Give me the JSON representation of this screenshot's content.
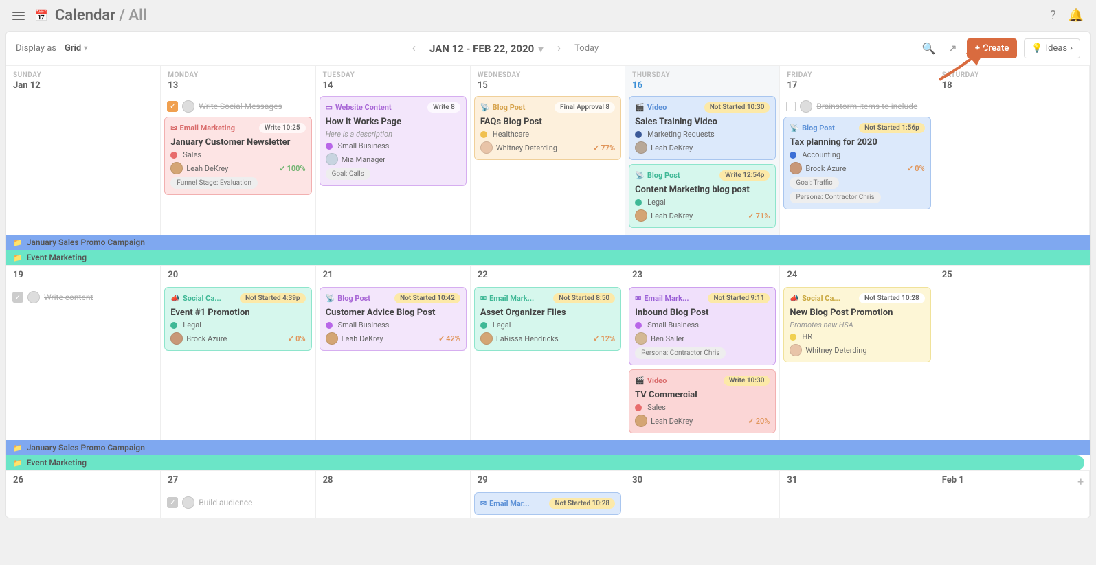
{
  "breadcrumb": {
    "app": "Calendar",
    "section": "All"
  },
  "toolbar": {
    "display_as_label": "Display as",
    "display_as_value": "Grid",
    "range": "JAN 12 - FEB 22, 2020",
    "today": "Today",
    "create": "Create",
    "ideas": "Ideas"
  },
  "days": [
    "SUNDAY",
    "MONDAY",
    "TUESDAY",
    "WEDNESDAY",
    "THURSDAY",
    "FRIDAY",
    "SATURDAY"
  ],
  "week1": {
    "dates": [
      "Jan 12",
      "13",
      "14",
      "15",
      "16",
      "17",
      "18"
    ],
    "strike_mon": "Write Social Messages",
    "strike_fri": "Brainstorm items to include",
    "mon_card": {
      "type": "Email Marketing",
      "pill": "Write 10:25",
      "title": "January Customer Newsletter",
      "tag": "Sales",
      "user": "Leah DeKrey",
      "pct": "100%",
      "chip": "Funnel Stage: Evaluation"
    },
    "tue_card": {
      "type": "Website Content",
      "pill": "Write 8",
      "title": "How It Works Page",
      "desc": "Here is a description",
      "tag": "Small Business",
      "user": "Mia Manager",
      "chip": "Goal: Calls"
    },
    "wed_card": {
      "type": "Blog Post",
      "pill": "Final Approval 8",
      "title": "FAQs Blog Post",
      "tag": "Healthcare",
      "user": "Whitney Deterding",
      "pct": "77%"
    },
    "thu_card1": {
      "type": "Video",
      "pill": "Not Started 10:30",
      "title": "Sales Training Video",
      "tag": "Marketing Requests",
      "user": "Leah DeKrey"
    },
    "thu_card2": {
      "type": "Blog Post",
      "pill": "Write 12:54p",
      "title": "Content Marketing blog post",
      "tag": "Legal",
      "user": "Leah DeKrey",
      "pct": "71%"
    },
    "fri_card": {
      "type": "Blog Post",
      "pill": "Not Started 1:56p",
      "title": "Tax planning for 2020",
      "tag": "Accounting",
      "user": "Brock Azure",
      "pct": "0%",
      "chip1": "Goal: Traffic",
      "chip2": "Persona: Contractor Chris"
    }
  },
  "strips": {
    "s1": "January Sales Promo Campaign",
    "s2": "Event Marketing"
  },
  "week2": {
    "dates": [
      "19",
      "20",
      "21",
      "22",
      "23",
      "24",
      "25"
    ],
    "strike_sun": "Write content",
    "mon": {
      "type": "Social Ca...",
      "pill": "Not Started 4:39p",
      "title": "Event #1 Promotion",
      "tag": "Legal",
      "user": "Brock Azure",
      "pct": "0%"
    },
    "tue": {
      "type": "Blog Post",
      "pill": "Not Started 10:42",
      "title": "Customer Advice Blog Post",
      "tag": "Small Business",
      "user": "Leah DeKrey",
      "pct": "42%"
    },
    "wed": {
      "type": "Email Mark...",
      "pill": "Not Started 8:50",
      "title": "Asset Organizer Files",
      "tag": "Legal",
      "user": "LaRissa Hendricks",
      "pct": "12%"
    },
    "thu1": {
      "type": "Email Mark...",
      "pill": "Not Started 9:11",
      "title": "Inbound Blog Post",
      "tag": "Small Business",
      "user": "Ben Sailer",
      "chip": "Persona: Contractor Chris"
    },
    "thu2": {
      "type": "Video",
      "pill": "Write 10:30",
      "title": "TV Commercial",
      "tag": "Sales",
      "user": "Leah DeKrey",
      "pct": "20%"
    },
    "fri": {
      "type": "Social Ca...",
      "pill": "Not Started 10:28",
      "title": "New Blog Post Promotion",
      "desc": "Promotes new HSA",
      "tag": "HR",
      "user": "Whitney Deterding"
    }
  },
  "week3": {
    "dates": [
      "26",
      "27",
      "28",
      "29",
      "30",
      "31",
      "Feb 1"
    ],
    "strike_mon": "Build audience",
    "wed": {
      "type": "Email Mar...",
      "pill": "Not Started 10:28"
    }
  },
  "colors": {
    "pink": "#fde4e4",
    "pinkB": "#f2b0b0",
    "pinkT": "#d96b6b",
    "purple": "#f3e6fb",
    "purpleB": "#d6aef0",
    "purpleT": "#a866d6",
    "orange": "#fdf0dc",
    "orangeB": "#f0d09a",
    "orangeT": "#d6a24a",
    "blue": "#dce9fb",
    "blueB": "#a9c6ef",
    "blueT": "#5a8fd6",
    "teal": "#d6f7ed",
    "tealB": "#8ee5cc",
    "tealT": "#3fb896",
    "violet": "#f0e0fb",
    "violetB": "#cda0ee",
    "violetT": "#9a5fd6",
    "yellow": "#fdf6d6",
    "yellowB": "#f0e29a",
    "yellowT": "#c9a83f",
    "red2": "#fbd6d6"
  }
}
